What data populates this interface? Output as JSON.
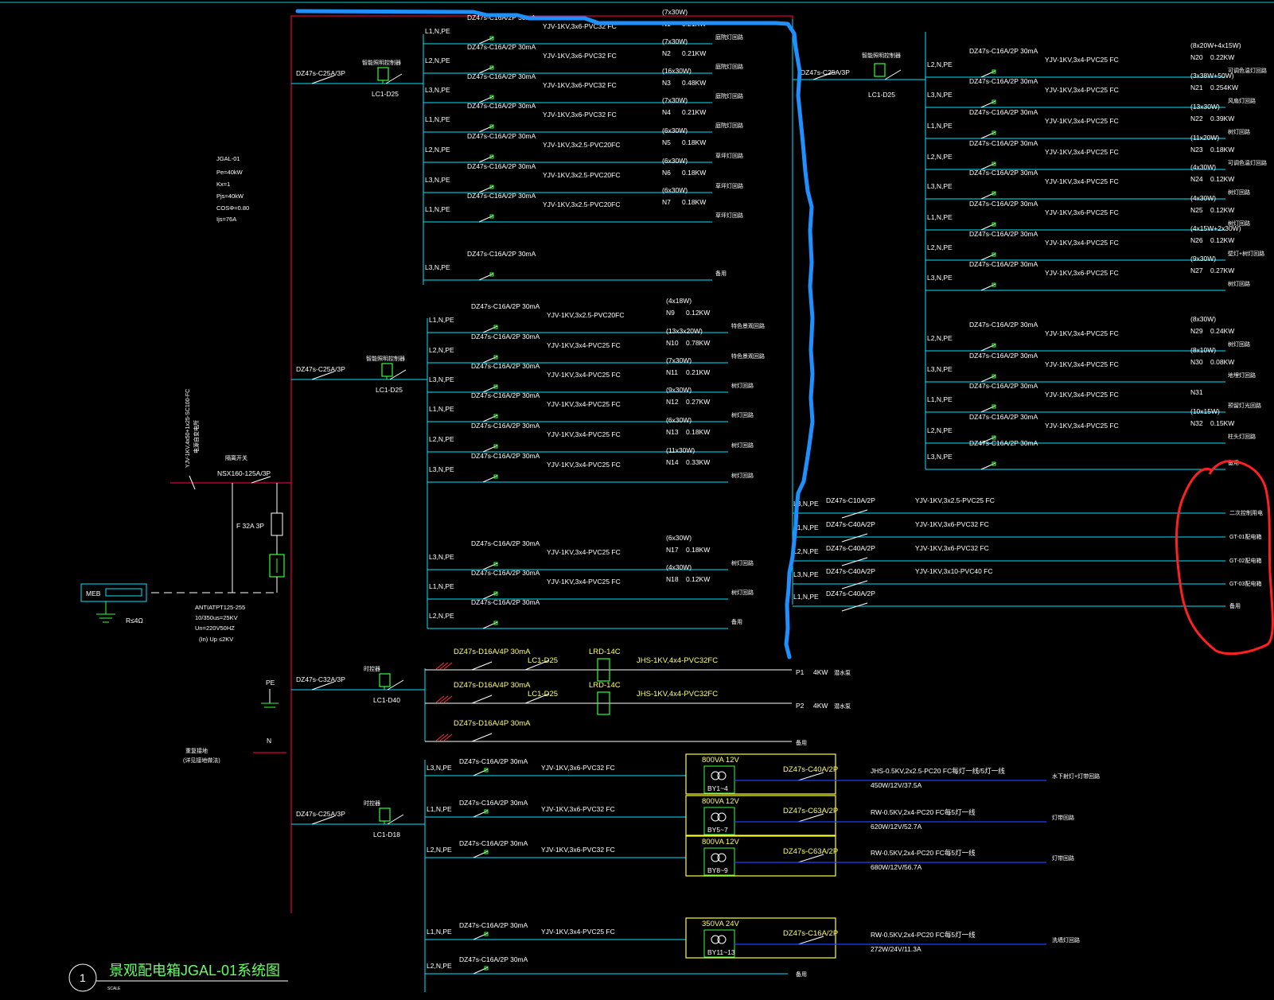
{
  "title": {
    "number": "1",
    "text": "景观配电箱JGAL-01系统图",
    "scale": "SCALE"
  },
  "panel": {
    "lines": [
      "JGAL-01",
      "Pe=40kW",
      "Kx=1",
      "Pjs=40kW",
      "COSΦ=0.80",
      "Ijs=76A"
    ]
  },
  "incoming": {
    "cable": "YJV-1KV,4x50+1x25-SC100-FC",
    "cable_note": "电源自变电所",
    "main_switch_label": "隔离开关",
    "main_switch": "NSX160-125A/3P",
    "fuse": "F 32A 3P",
    "spd": [
      "ANTIATPT125-255",
      "10/350us=25KV",
      "Un=220V50HZ",
      "(In) Up  ≤2KV"
    ],
    "meb": "MEB",
    "earth": "R≤4Ω",
    "pe": "PE",
    "n": "N",
    "n_note": [
      "重复接地",
      "(详见接地做法)"
    ]
  },
  "groups": {
    "g1": {
      "breaker": "DZ47s-C25A/3P",
      "contactor_label": "智能照明控制器",
      "contactor": "LC1-D25"
    },
    "g2": {
      "breaker": "DZ47s-C25A/3P",
      "contactor_label": "智能照明控制器",
      "contactor": "LC1-D25"
    },
    "g3": {
      "breaker": "DZ47s-C32A/3P",
      "contactor_label": "时控器",
      "contactor": "LC1-D40"
    },
    "g4": {
      "breaker": "DZ47s-C25A/3P",
      "contactor_label": "时控器",
      "contactor": "LC1-D18"
    },
    "g5": {
      "breaker": "DZ47s-C25A/3P",
      "contactor_label": "智能照明控制器",
      "contactor": "LC1-D25"
    }
  },
  "circuits_a": [
    {
      "phase": "L1,N,PE",
      "breaker": "DZ47s-C16A/2P 30mA",
      "cable": "YJV-1KV,3x6-PVC32  FC",
      "load": "(7x30W)",
      "id": "N1",
      "power": "0.21KW",
      "desc": "庭院灯回路"
    },
    {
      "phase": "L2,N,PE",
      "breaker": "DZ47s-C16A/2P 30mA",
      "cable": "YJV-1KV,3x6-PVC32  FC",
      "load": "(7x30W)",
      "id": "N2",
      "power": "0.21KW",
      "desc": "庭院灯回路"
    },
    {
      "phase": "L3,N,PE",
      "breaker": "DZ47s-C16A/2P 30mA",
      "cable": "YJV-1KV,3x6-PVC32  FC",
      "load": "(16x30W)",
      "id": "N3",
      "power": "0.48KW",
      "desc": "庭院灯回路"
    },
    {
      "phase": "L1,N,PE",
      "breaker": "DZ47s-C16A/2P 30mA",
      "cable": "YJV-1KV,3x6-PVC32  FC",
      "load": "(7x30W)",
      "id": "N4",
      "power": "0.21KW",
      "desc": "庭院灯回路"
    },
    {
      "phase": "L2,N,PE",
      "breaker": "DZ47s-C16A/2P 30mA",
      "cable": "YJV-1KV,3x2.5-PVC20FC",
      "load": "(6x30W)",
      "id": "N5",
      "power": "0.18KW",
      "desc": "草坪灯回路"
    },
    {
      "phase": "L3,N,PE",
      "breaker": "DZ47s-C16A/2P 30mA",
      "cable": "YJV-1KV,3x2.5-PVC20FC",
      "load": "(6x30W)",
      "id": "N6",
      "power": "0.18KW",
      "desc": "草坪灯回路"
    },
    {
      "phase": "L1,N,PE",
      "breaker": "DZ47s-C16A/2P 30mA",
      "cable": "YJV-1KV,3x2.5-PVC20FC",
      "load": "(6x30W)",
      "id": "N7",
      "power": "0.18KW",
      "desc": "草坪灯回路"
    },
    {
      "phase": "L3,N,PE",
      "breaker": "DZ47s-C16A/2P 30mA",
      "cable": "",
      "load": "",
      "id": "",
      "power": "",
      "desc": "备用"
    }
  ],
  "circuits_b": [
    {
      "phase": "L1,N,PE",
      "breaker": "DZ47s-C16A/2P 30mA",
      "cable": "YJV-1KV,3x2.5-PVC20FC",
      "load": "(4x18W)",
      "id": "N9",
      "power": "0.12KW",
      "desc": "特色景观回路"
    },
    {
      "phase": "L2,N,PE",
      "breaker": "DZ47s-C16A/2P 30mA",
      "cable": "YJV-1KV,3x4-PVC25  FC",
      "load": "(13x3x20W)",
      "id": "N10",
      "power": "0.78KW",
      "desc": "特色景观回路"
    },
    {
      "phase": "L3,N,PE",
      "breaker": "DZ47s-C16A/2P 30mA",
      "cable": "YJV-1KV,3x4-PVC25  FC",
      "load": "(7x30W)",
      "id": "N11",
      "power": "0.21KW",
      "desc": "树灯回路"
    },
    {
      "phase": "L1,N,PE",
      "breaker": "DZ47s-C16A/2P 30mA",
      "cable": "YJV-1KV,3x4-PVC25  FC",
      "load": "(9x30W)",
      "id": "N12",
      "power": "0.27KW",
      "desc": "树灯回路"
    },
    {
      "phase": "L2,N,PE",
      "breaker": "DZ47s-C16A/2P 30mA",
      "cable": "YJV-1KV,3x4-PVC25  FC",
      "load": "(6x30W)",
      "id": "N13",
      "power": "0.18KW",
      "desc": "树灯回路"
    },
    {
      "phase": "L3,N,PE",
      "breaker": "DZ47s-C16A/2P 30mA",
      "cable": "YJV-1KV,3x4-PVC25  FC",
      "load": "(11x30W)",
      "id": "N14",
      "power": "0.33KW",
      "desc": "树灯回路"
    },
    {
      "phase": "L3,N,PE",
      "breaker": "DZ47s-C16A/2P 30mA",
      "cable": "YJV-1KV,3x4-PVC25  FC",
      "load": "(6x30W)",
      "id": "N17",
      "power": "0.18KW",
      "desc": "树灯回路"
    },
    {
      "phase": "L1,N,PE",
      "breaker": "DZ47s-C16A/2P 30mA",
      "cable": "YJV-1KV,3x4-PVC25  FC",
      "load": "(4x30W)",
      "id": "N18",
      "power": "0.12KW",
      "desc": "树灯回路"
    },
    {
      "phase": "L2,N,PE",
      "breaker": "DZ47s-C16A/2P 30mA",
      "cable": "",
      "load": "",
      "id": "",
      "power": "",
      "desc": "备用"
    }
  ],
  "circuits_c": [
    {
      "phase": "L2,N,PE",
      "breaker": "DZ47s-C16A/2P 30mA",
      "cable": "YJV-1KV,3x4-PVC25  FC",
      "load": "(8x20W+4x15W)",
      "id": "N20",
      "power": "0.22KW",
      "desc": "可调色温灯回路"
    },
    {
      "phase": "L3,N,PE",
      "breaker": "DZ47s-C16A/2P 30mA",
      "cable": "YJV-1KV,3x4-PVC25  FC",
      "load": "(3x38W+50W)",
      "id": "N21",
      "power": "0.254KW",
      "desc": "风扇灯回路"
    },
    {
      "phase": "L1,N,PE",
      "breaker": "DZ47s-C16A/2P 30mA",
      "cable": "YJV-1KV,3x4-PVC25  FC",
      "load": "(13x30W)",
      "id": "N22",
      "power": "0.39KW",
      "desc": "树灯回路"
    },
    {
      "phase": "L2,N,PE",
      "breaker": "DZ47s-C16A/2P 30mA",
      "cable": "YJV-1KV,3x4-PVC25  FC",
      "load": "(11x20W)",
      "id": "N23",
      "power": "0.18KW",
      "desc": "可调色温灯回路"
    },
    {
      "phase": "L3,N,PE",
      "breaker": "DZ47s-C16A/2P 30mA",
      "cable": "YJV-1KV,3x4-PVC25  FC",
      "load": "(4x30W)",
      "id": "N24",
      "power": "0.12KW",
      "desc": "树灯回路"
    },
    {
      "phase": "L1,N,PE",
      "breaker": "DZ47s-C16A/2P 30mA",
      "cable": "YJV-1KV,3x6-PVC25  FC",
      "load": "(4x30W)",
      "id": "N25",
      "power": "0.12KW",
      "desc": "树灯回路"
    },
    {
      "phase": "L2,N,PE",
      "breaker": "DZ47s-C16A/2P 30mA",
      "cable": "YJV-1KV,3x4-PVC25  FC",
      "load": "(4x15W+2x30W)",
      "id": "N26",
      "power": "0.12KW",
      "desc": "壁灯+树灯回路"
    },
    {
      "phase": "L3,N,PE",
      "breaker": "DZ47s-C16A/2P 30mA",
      "cable": "YJV-1KV,3x6-PVC25  FC",
      "load": "(9x30W)",
      "id": "N27",
      "power": "0.27KW",
      "desc": "树灯回路"
    },
    {
      "phase": "L2,N,PE",
      "breaker": "DZ47s-C16A/2P 30mA",
      "cable": "YJV-1KV,3x4-PVC25  FC",
      "load": "(8x30W)",
      "id": "N29",
      "power": "0.24KW",
      "desc": "树灯回路"
    },
    {
      "phase": "L3,N,PE",
      "breaker": "DZ47s-C16A/2P 30mA",
      "cable": "YJV-1KV,3x4-PVC25  FC",
      "load": "(8x10W)",
      "id": "N30",
      "power": "0.08KW",
      "desc": "地埋灯回路"
    },
    {
      "phase": "L1,N,PE",
      "breaker": "DZ47s-C16A/2P 30mA",
      "cable": "YJV-1KV,3x4-PVC25  FC",
      "load": "",
      "id": "N31",
      "power": "",
      "desc": "预留灯光回路"
    },
    {
      "phase": "L2,N,PE",
      "breaker": "DZ47s-C16A/2P 30mA",
      "cable": "YJV-1KV,3x4-PVC25  FC",
      "load": "(10x15W)",
      "id": "N32",
      "power": "0.15KW",
      "desc": "柱头灯回路"
    },
    {
      "phase": "L3,N,PE",
      "breaker": "DZ47s-C16A/2P 30mA",
      "cable": "",
      "load": "",
      "id": "",
      "power": "",
      "desc": "备用"
    }
  ],
  "circuits_d": [
    {
      "phase": "L3,N,PE",
      "breaker": "DZ47s-C10A/2P",
      "cable": "YJV-1KV,3x2.5-PVC25  FC",
      "desc": "二次控制用电"
    },
    {
      "phase": "L1,N,PE",
      "breaker": "DZ47s-C40A/2P",
      "cable": "YJV-1KV,3x6-PVC32  FC",
      "desc": "GT-01配电箱"
    },
    {
      "phase": "L2,N,PE",
      "breaker": "DZ47s-C40A/2P",
      "cable": "YJV-1KV,3x6-PVC32  FC",
      "desc": "GT-02配电箱"
    },
    {
      "phase": "L3,N,PE",
      "breaker": "DZ47s-C40A/2P",
      "cable": "YJV-1KV,3x10-PVC40  FC",
      "desc": "GT-03配电箱"
    },
    {
      "phase": "L1,N,PE",
      "breaker": "DZ47s-C40A/2P",
      "cable": "",
      "desc": "备用"
    }
  ],
  "circuits_e": [
    {
      "breaker": "DZ47s-D16A/4P 30mA",
      "contactor": "LC1-D25",
      "relay": "LRD-14C",
      "cable": "JHS-1KV,4x4-PVC32FC",
      "id": "P1",
      "power": "4KW",
      "desc": "潜水泵"
    },
    {
      "breaker": "DZ47s-D16A/4P 30mA",
      "contactor": "LC1-D25",
      "relay": "LRD-14C",
      "cable": "JHS-1KV,4x4-PVC32FC",
      "id": "P2",
      "power": "4KW",
      "desc": "潜水泵"
    },
    {
      "breaker": "DZ47s-D16A/4P 30mA",
      "contactor": "",
      "relay": "",
      "cable": "",
      "id": "",
      "power": "",
      "desc": "备用"
    }
  ],
  "circuits_f": [
    {
      "phase": "L3,N,PE",
      "breaker": "DZ47s-C16A/2P 30mA",
      "cable": "YJV-1KV,3x6-PVC32  FC",
      "xfmr": "800VA 12V",
      "xfmr_id": "BY1~4",
      "out_breaker": "DZ47s-C40A/2P",
      "out_cable": "JHS-0.5KV,2x2.5-PC20  FC每灯一线/5灯一线",
      "out_load": "450W/12V/37.5A",
      "desc": "水下射灯+灯带回路"
    },
    {
      "phase": "L1,N,PE",
      "breaker": "DZ47s-C16A/2P 30mA",
      "cable": "YJV-1KV,3x6-PVC32  FC",
      "xfmr": "800VA 12V",
      "xfmr_id": "BY5~7",
      "out_breaker": "DZ47s-C63A/2P",
      "out_cable": "RW-0.5KV,2x4-PC20  FC每5灯一线",
      "out_load": "620W/12V/52.7A",
      "desc": "灯带回路"
    },
    {
      "phase": "L2,N,PE",
      "breaker": "DZ47s-C16A/2P 30mA",
      "cable": "YJV-1KV,3x6-PVC32  FC",
      "xfmr": "800VA 12V",
      "xfmr_id": "BY8~9",
      "out_breaker": "DZ47s-C63A/2P",
      "out_cable": "RW-0.5KV,2x4-PC20  FC每5灯一线",
      "out_load": "680W/12V/56.7A",
      "desc": "灯带回路"
    },
    {
      "phase": "L1,N,PE",
      "breaker": "DZ47s-C16A/2P 30mA",
      "cable": "YJV-1KV,3x4-PVC25  FC",
      "xfmr": "350VA 24V",
      "xfmr_id": "BY11~13",
      "out_breaker": "DZ47s-C16A/2P",
      "out_cable": "RW-0.5KV,2x4-PC20  FC每5灯一线",
      "out_load": "272W/24V/11.3A",
      "desc": "洗墙灯回路"
    },
    {
      "phase": "L2,N,PE",
      "breaker": "DZ47s-C16A/2P 30mA",
      "cable": "",
      "xfmr": "",
      "xfmr_id": "",
      "out_breaker": "",
      "out_cable": "",
      "out_load": "",
      "desc": "备用"
    }
  ],
  "colors": {
    "bg": "#000000",
    "cyan": "#00e5ff",
    "crimson": "#d6003c",
    "green": "#33ff33",
    "yellow": "#ffff33",
    "blue_line": "#2040ff",
    "annotation_blue": "#1e90ff",
    "annotation_red": "#ff2020"
  }
}
